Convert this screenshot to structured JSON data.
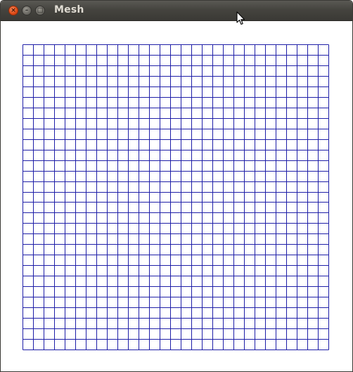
{
  "window": {
    "title": "Mesh",
    "controls": {
      "close_icon": "close-icon",
      "minimize_icon": "minimize-icon",
      "maximize_icon": "maximize-icon"
    }
  },
  "mesh": {
    "rows": 29,
    "cols": 29,
    "line_color": "#1f1fa8",
    "border_color": "#1f1fa8",
    "background": "#ffffff"
  },
  "cursor": {
    "icon": "pointer-arrow-icon"
  }
}
